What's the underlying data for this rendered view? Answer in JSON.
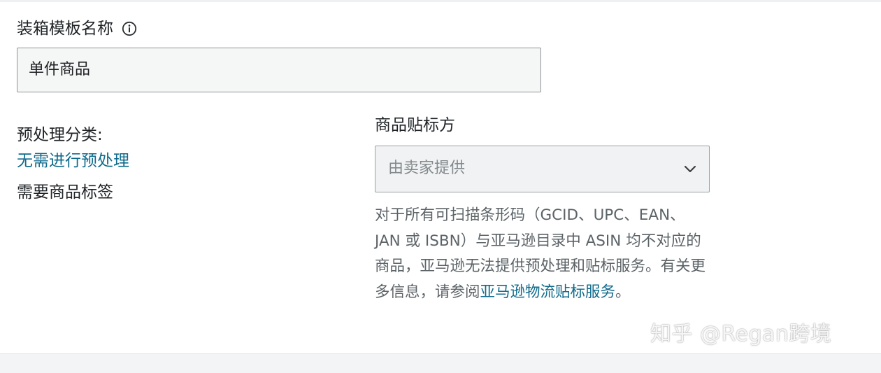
{
  "box_template": {
    "label": "装箱模板名称",
    "value": "单件商品"
  },
  "prep": {
    "category_label": "预处理分类:",
    "category_value": "无需进行预处理",
    "label_required": "需要商品标签"
  },
  "labeling": {
    "title": "商品贴标方",
    "selected": "由卖家提供",
    "help_text_before": "对于所有可扫描条形码（GCID、UPC、EAN、JAN 或 ISBN）与亚马逊目录中 ASIN 均不对应的商品，亚马逊无法提供预处理和贴标服务。有关更多信息，请参阅",
    "help_link": "亚马逊物流贴标服务",
    "help_text_after": "。"
  },
  "watermark": "知乎 @Regan跨境",
  "colors": {
    "link": "#0f6b8c",
    "text": "#1f2326",
    "muted": "#5c6367"
  }
}
